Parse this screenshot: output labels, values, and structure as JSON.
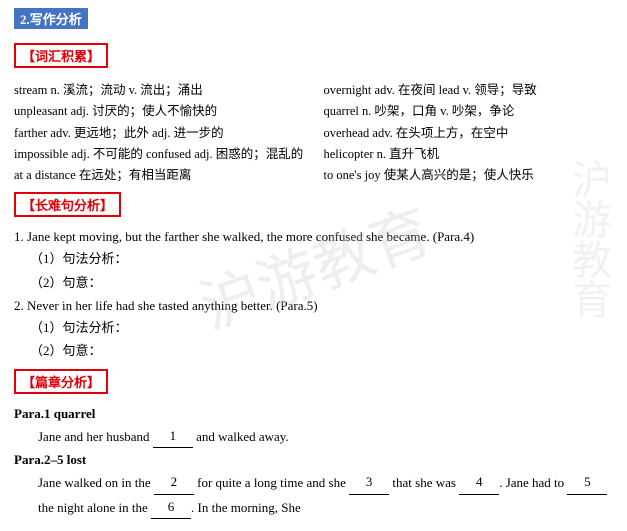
{
  "header": {
    "top_label": "2.写作分析"
  },
  "vocab": {
    "section_title": "【词汇积累】",
    "items": [
      {
        "left": "stream n. 溪流；流动 v. 流出；涌出",
        "right": "overnight adv. 在夜间  lead v. 领导；导致"
      },
      {
        "left": "unpleasant adj. 讨厌的；使人不愉快的",
        "right": "quarrel n. 吵架，口角 v. 吵架，争论"
      },
      {
        "left": "farther adv. 更远地；此外 adj. 进一步的",
        "right": "overhead adv. 在头项上方，在空中"
      },
      {
        "left": "impossible adj. 不可能的  confused adj. 困惑的；混乱的",
        "right": "helicopter n. 直升飞机"
      },
      {
        "left": "at a distance 在远处；有相当距离",
        "right": "to one's joy 使某人高兴的是；使人快乐"
      }
    ]
  },
  "long_sentence": {
    "section_title": "【长难句分析】",
    "items": [
      {
        "number": "1.",
        "text": "Jane kept moving, but the farther she walked, the more confused she became. (Para.4)",
        "sub1_label": "（1）句法分析：",
        "sub1_value": "",
        "sub2_label": "（2）句意：",
        "sub2_value": ""
      },
      {
        "number": "2.",
        "text": "Never in her life had she tasted anything better. (Para.5)",
        "sub1_label": "（1）句法分析：",
        "sub1_value": "",
        "sub2_label": "（2）句意：",
        "sub2_value": ""
      }
    ]
  },
  "para_analysis": {
    "section_title": "【篇章分析】",
    "paras": [
      {
        "label": "Para.1 quarrel",
        "content": "Jane and her husband ____1___ and walked away."
      },
      {
        "label": "Para.2–5 lost",
        "content": "Jane walked on in the ____2_____ for quite a long time and she ____3_____ that she was ____4____. Jane had to ____5_____ the night alone in the ____6____. In the morning, She"
      }
    ]
  },
  "watermark": "沪游教育"
}
